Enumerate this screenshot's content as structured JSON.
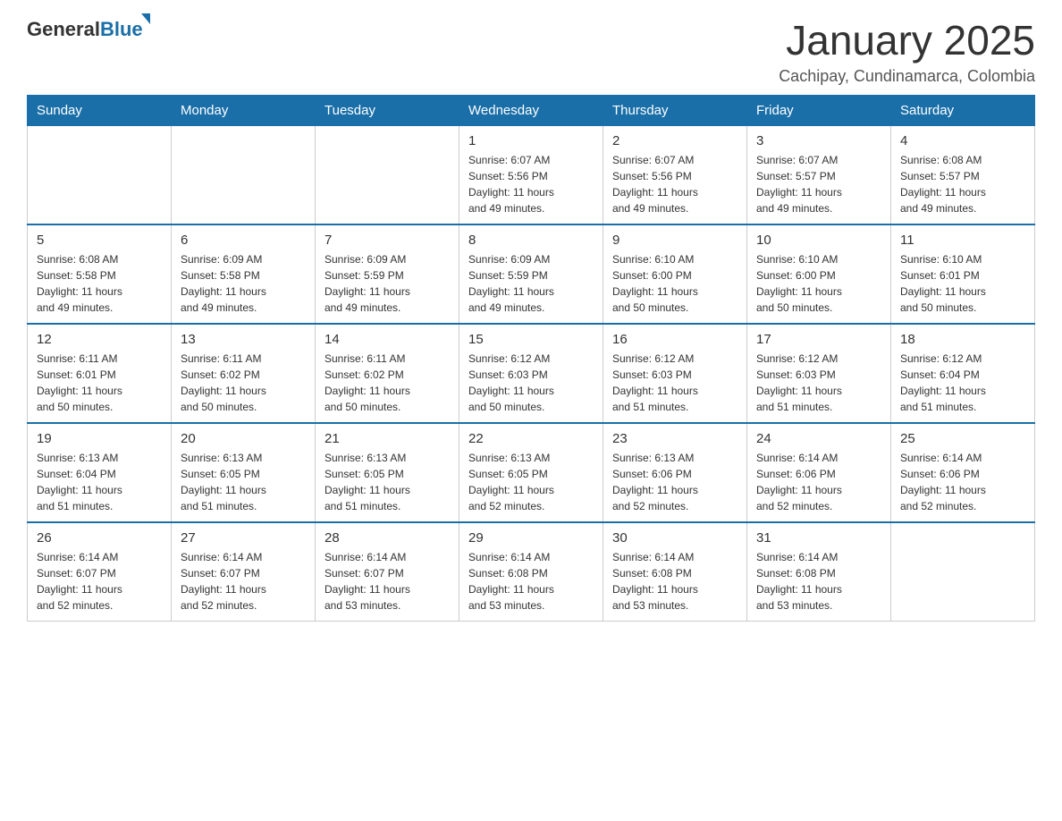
{
  "header": {
    "logo": {
      "general": "General",
      "blue": "Blue"
    },
    "title": "January 2025",
    "location": "Cachipay, Cundinamarca, Colombia"
  },
  "days_of_week": [
    "Sunday",
    "Monday",
    "Tuesday",
    "Wednesday",
    "Thursday",
    "Friday",
    "Saturday"
  ],
  "weeks": [
    [
      {
        "day": "",
        "sunrise": "",
        "sunset": "",
        "daylight": ""
      },
      {
        "day": "",
        "sunrise": "",
        "sunset": "",
        "daylight": ""
      },
      {
        "day": "",
        "sunrise": "",
        "sunset": "",
        "daylight": ""
      },
      {
        "day": "1",
        "sunrise": "6:07 AM",
        "sunset": "5:56 PM",
        "daylight": "11 hours and 49 minutes."
      },
      {
        "day": "2",
        "sunrise": "6:07 AM",
        "sunset": "5:56 PM",
        "daylight": "11 hours and 49 minutes."
      },
      {
        "day": "3",
        "sunrise": "6:07 AM",
        "sunset": "5:57 PM",
        "daylight": "11 hours and 49 minutes."
      },
      {
        "day": "4",
        "sunrise": "6:08 AM",
        "sunset": "5:57 PM",
        "daylight": "11 hours and 49 minutes."
      }
    ],
    [
      {
        "day": "5",
        "sunrise": "6:08 AM",
        "sunset": "5:58 PM",
        "daylight": "11 hours and 49 minutes."
      },
      {
        "day": "6",
        "sunrise": "6:09 AM",
        "sunset": "5:58 PM",
        "daylight": "11 hours and 49 minutes."
      },
      {
        "day": "7",
        "sunrise": "6:09 AM",
        "sunset": "5:59 PM",
        "daylight": "11 hours and 49 minutes."
      },
      {
        "day": "8",
        "sunrise": "6:09 AM",
        "sunset": "5:59 PM",
        "daylight": "11 hours and 49 minutes."
      },
      {
        "day": "9",
        "sunrise": "6:10 AM",
        "sunset": "6:00 PM",
        "daylight": "11 hours and 50 minutes."
      },
      {
        "day": "10",
        "sunrise": "6:10 AM",
        "sunset": "6:00 PM",
        "daylight": "11 hours and 50 minutes."
      },
      {
        "day": "11",
        "sunrise": "6:10 AM",
        "sunset": "6:01 PM",
        "daylight": "11 hours and 50 minutes."
      }
    ],
    [
      {
        "day": "12",
        "sunrise": "6:11 AM",
        "sunset": "6:01 PM",
        "daylight": "11 hours and 50 minutes."
      },
      {
        "day": "13",
        "sunrise": "6:11 AM",
        "sunset": "6:02 PM",
        "daylight": "11 hours and 50 minutes."
      },
      {
        "day": "14",
        "sunrise": "6:11 AM",
        "sunset": "6:02 PM",
        "daylight": "11 hours and 50 minutes."
      },
      {
        "day": "15",
        "sunrise": "6:12 AM",
        "sunset": "6:03 PM",
        "daylight": "11 hours and 50 minutes."
      },
      {
        "day": "16",
        "sunrise": "6:12 AM",
        "sunset": "6:03 PM",
        "daylight": "11 hours and 51 minutes."
      },
      {
        "day": "17",
        "sunrise": "6:12 AM",
        "sunset": "6:03 PM",
        "daylight": "11 hours and 51 minutes."
      },
      {
        "day": "18",
        "sunrise": "6:12 AM",
        "sunset": "6:04 PM",
        "daylight": "11 hours and 51 minutes."
      }
    ],
    [
      {
        "day": "19",
        "sunrise": "6:13 AM",
        "sunset": "6:04 PM",
        "daylight": "11 hours and 51 minutes."
      },
      {
        "day": "20",
        "sunrise": "6:13 AM",
        "sunset": "6:05 PM",
        "daylight": "11 hours and 51 minutes."
      },
      {
        "day": "21",
        "sunrise": "6:13 AM",
        "sunset": "6:05 PM",
        "daylight": "11 hours and 51 minutes."
      },
      {
        "day": "22",
        "sunrise": "6:13 AM",
        "sunset": "6:05 PM",
        "daylight": "11 hours and 52 minutes."
      },
      {
        "day": "23",
        "sunrise": "6:13 AM",
        "sunset": "6:06 PM",
        "daylight": "11 hours and 52 minutes."
      },
      {
        "day": "24",
        "sunrise": "6:14 AM",
        "sunset": "6:06 PM",
        "daylight": "11 hours and 52 minutes."
      },
      {
        "day": "25",
        "sunrise": "6:14 AM",
        "sunset": "6:06 PM",
        "daylight": "11 hours and 52 minutes."
      }
    ],
    [
      {
        "day": "26",
        "sunrise": "6:14 AM",
        "sunset": "6:07 PM",
        "daylight": "11 hours and 52 minutes."
      },
      {
        "day": "27",
        "sunrise": "6:14 AM",
        "sunset": "6:07 PM",
        "daylight": "11 hours and 52 minutes."
      },
      {
        "day": "28",
        "sunrise": "6:14 AM",
        "sunset": "6:07 PM",
        "daylight": "11 hours and 53 minutes."
      },
      {
        "day": "29",
        "sunrise": "6:14 AM",
        "sunset": "6:08 PM",
        "daylight": "11 hours and 53 minutes."
      },
      {
        "day": "30",
        "sunrise": "6:14 AM",
        "sunset": "6:08 PM",
        "daylight": "11 hours and 53 minutes."
      },
      {
        "day": "31",
        "sunrise": "6:14 AM",
        "sunset": "6:08 PM",
        "daylight": "11 hours and 53 minutes."
      },
      {
        "day": "",
        "sunrise": "",
        "sunset": "",
        "daylight": ""
      }
    ]
  ],
  "labels": {
    "sunrise": "Sunrise:",
    "sunset": "Sunset:",
    "daylight": "Daylight:"
  }
}
